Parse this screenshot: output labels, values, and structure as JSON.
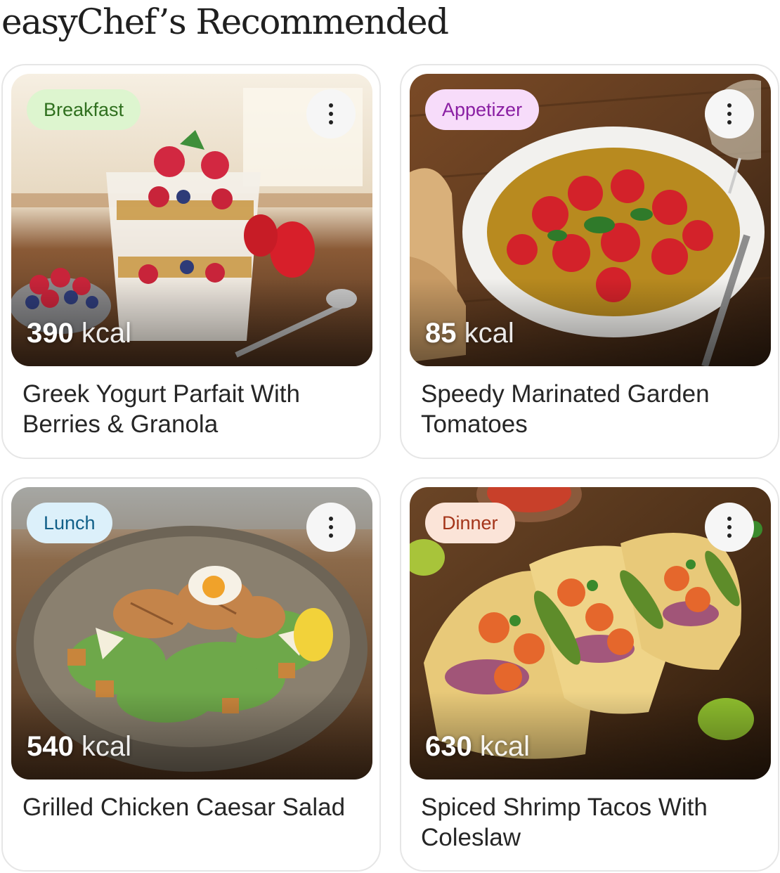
{
  "page": {
    "title": "easyChef’s Recommended"
  },
  "colors": {
    "breakfast_bg": "#ddf5cf",
    "breakfast_fg": "#2f6f1e",
    "appetizer_bg": "#f7dcfa",
    "appetizer_fg": "#8a1fa3",
    "lunch_bg": "#dcf0fa",
    "lunch_fg": "#116089",
    "dinner_bg": "#fbe4d8",
    "dinner_fg": "#a4351a",
    "card_border": "#e6e6e6"
  },
  "recipes": [
    {
      "category": "Breakfast",
      "calories": "390",
      "unit": "kcal",
      "title": "Greek Yogurt Parfait With Berries & Granola",
      "menu_icon": "more-vertical-icon",
      "image": "greek-yogurt-parfait-photo"
    },
    {
      "category": "Appetizer",
      "calories": "85",
      "unit": "kcal",
      "title": "Speedy Marinated Garden Tomatoes",
      "menu_icon": "more-vertical-icon",
      "image": "marinated-tomatoes-photo"
    },
    {
      "category": "Lunch",
      "calories": "540",
      "unit": "kcal",
      "title": "Grilled Chicken Caesar Salad",
      "menu_icon": "more-vertical-icon",
      "image": "chicken-caesar-salad-photo"
    },
    {
      "category": "Dinner",
      "calories": "630",
      "unit": "kcal",
      "title": "Spiced Shrimp Tacos With Coleslaw",
      "menu_icon": "more-vertical-icon",
      "image": "shrimp-tacos-photo"
    }
  ]
}
